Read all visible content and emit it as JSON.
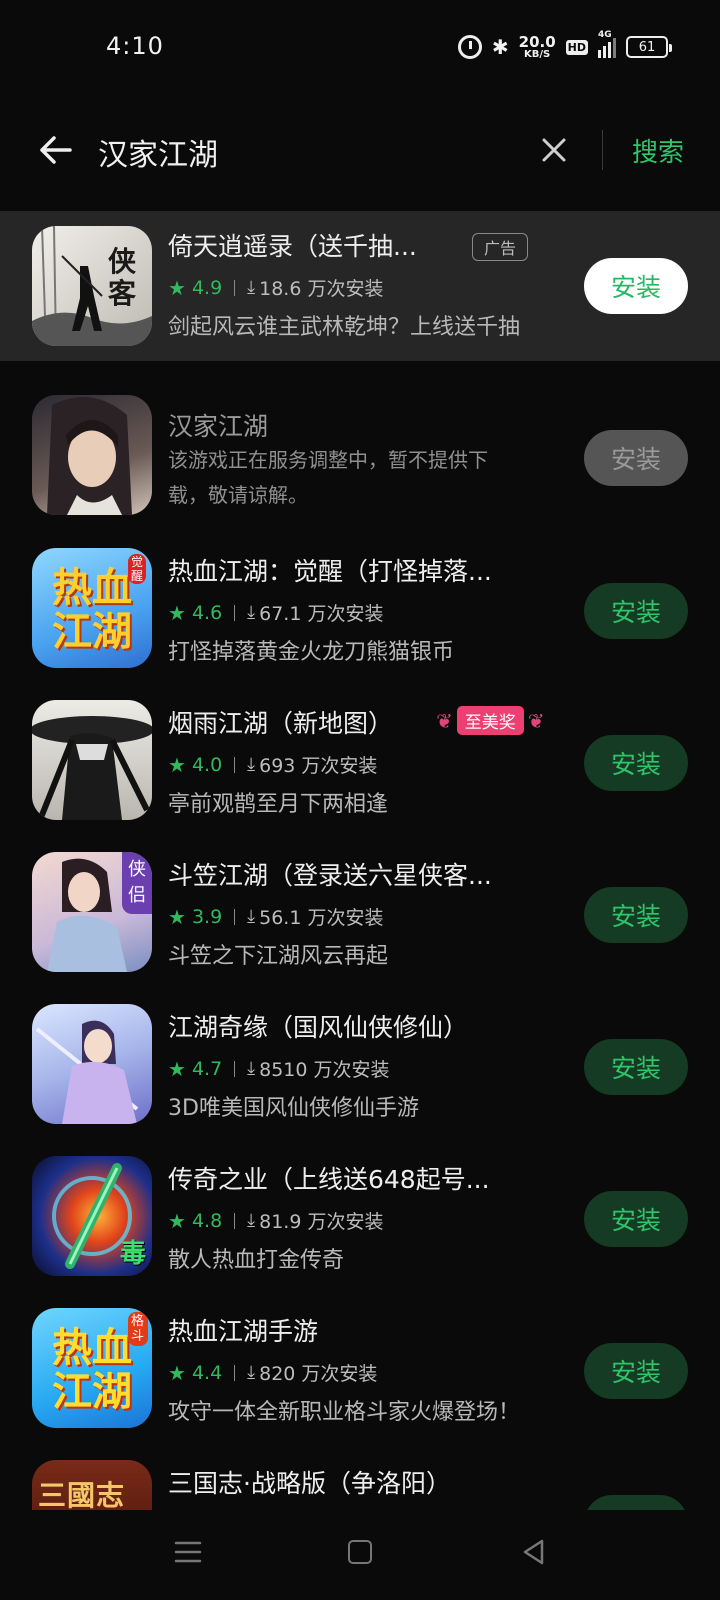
{
  "status": {
    "time": "4:10",
    "net_speed": "20.0",
    "net_unit": "KB/S",
    "hd": "HD",
    "network": "4G",
    "battery": "61"
  },
  "search": {
    "query": "汉家江湖",
    "button": "搜索"
  },
  "colors": {
    "accent": "#2fc56a",
    "background": "#0a0a0a",
    "ad_row": "#262626",
    "award": "#ee3f72"
  },
  "ad_label": "广告",
  "apps": [
    {
      "name": "倚天逍遥录（送千抽...",
      "rating": "4.9",
      "installs": "18.6 万次安装",
      "desc": "剑起风云谁主武林乾坤？上线送千抽",
      "button": "安装"
    },
    {
      "name": "汉家江湖",
      "desc": "该游戏正在服务调整中，暂不提供下载，敬请谅解。",
      "button": "安装"
    },
    {
      "name": "热血江湖：觉醒（打怪掉落...",
      "rating": "4.6",
      "installs": "67.1 万次安装",
      "desc": "打怪掉落黄金火龙刀熊猫银币",
      "button": "安装"
    },
    {
      "name": "烟雨江湖（新地图）",
      "award": "至美奖",
      "rating": "4.0",
      "installs": "693 万次安装",
      "desc": "亭前观鹊至月下两相逢",
      "button": "安装"
    },
    {
      "name": "斗笠江湖（登录送六星侠客...",
      "rating": "3.9",
      "installs": "56.1 万次安装",
      "desc": "斗笠之下江湖风云再起",
      "button": "安装"
    },
    {
      "name": "江湖奇缘（国风仙侠修仙）",
      "rating": "4.7",
      "installs": "8510 万次安装",
      "desc": "3D唯美国风仙侠修仙手游",
      "button": "安装"
    },
    {
      "name": "传奇之业（上线送648起号...",
      "rating": "4.8",
      "installs": "81.9 万次安装",
      "desc": "散人热血打金传奇",
      "button": "安装"
    },
    {
      "name": "热血江湖手游",
      "rating": "4.4",
      "installs": "820 万次安装",
      "desc": "攻守一体全新职业格斗家火爆登场！",
      "button": "安装"
    },
    {
      "name": "三国志·战略版（争洛阳）"
    }
  ],
  "icon_text": {
    "app0": "侠客",
    "app2": "热血江湖",
    "app2_badge": "觉醒",
    "app4": "侠侣",
    "app6": "毒",
    "app7": "热血江湖",
    "app7_badge": "格斗",
    "app8": "三國志"
  }
}
